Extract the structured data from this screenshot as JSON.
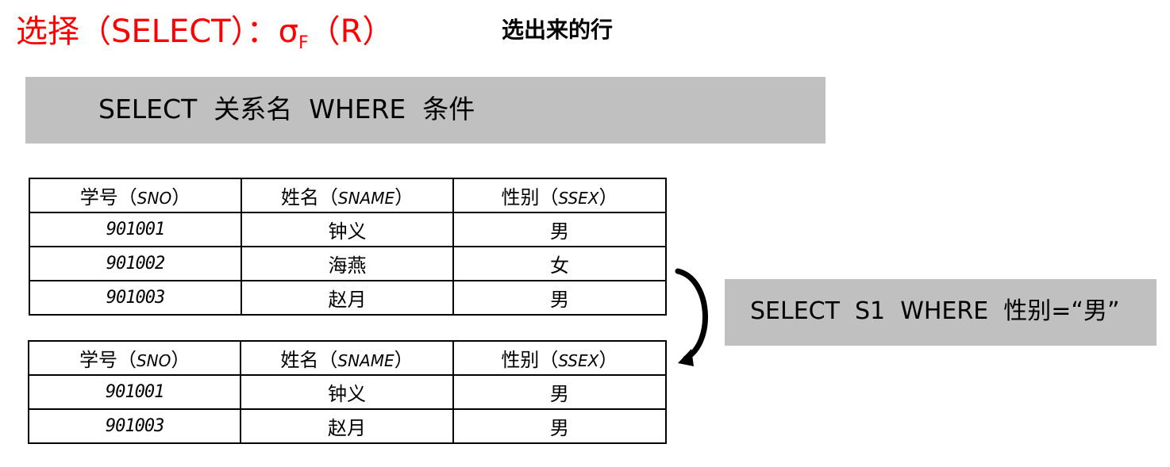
{
  "header": {
    "title_prefix": "选择（SELECT）：σ",
    "title_sub": "F",
    "title_suffix": "（R）",
    "subtitle": "选出来的行"
  },
  "syntax_box": {
    "text": "SELECT  关系名  WHERE  条件"
  },
  "columns": [
    {
      "label": "学号",
      "paren_open": "（",
      "code": "SNO",
      "paren_close": "）"
    },
    {
      "label": "姓名",
      "paren_open": "（",
      "code": "SNAME",
      "paren_close": "）"
    },
    {
      "label": "性别",
      "paren_open": "（",
      "code": "SSEX",
      "paren_close": "）"
    }
  ],
  "table_original": {
    "rows": [
      [
        "901001",
        "钟义",
        "男"
      ],
      [
        "901002",
        "海燕",
        "女"
      ],
      [
        "901003",
        "赵月",
        "男"
      ]
    ]
  },
  "table_result": {
    "rows": [
      [
        "901001",
        "钟义",
        "男"
      ],
      [
        "901003",
        "赵月",
        "男"
      ]
    ]
  },
  "query_box": {
    "text": "SELECT  S1  WHERE  性别=“男”"
  },
  "colors": {
    "title": "#ff0000",
    "box_fill": "#c0c0c0",
    "border": "#000000"
  }
}
